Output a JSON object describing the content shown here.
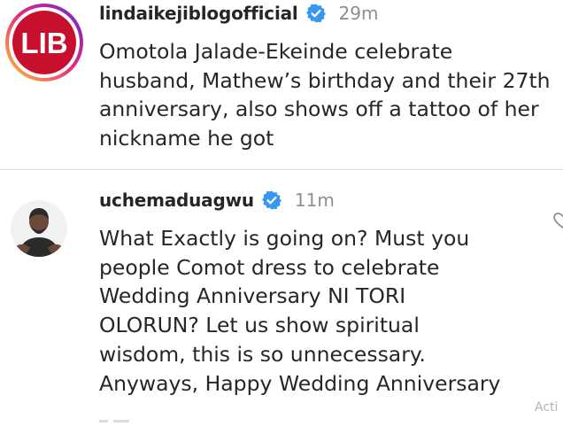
{
  "comments": [
    {
      "username": "lindaikejiblogofficial",
      "time": "29m",
      "verified": true,
      "avatar_text": "LIB",
      "text_lines": [
        "Omotola Jalade-Ekeinde celebrate",
        "husband, Mathew’s birthday and their 27th",
        "anniversary, also shows off a tattoo of her",
        "nickname he got"
      ]
    },
    {
      "username": "uchemaduagwu",
      "time": "11m",
      "verified": true,
      "text_lines": [
        "What Exactly is going on? Must you",
        "people Comot dress to celebrate",
        "Wedding Anniversary NI TORI",
        "OLORUN? Let us show spiritual",
        "wisdom, this is so unnecessary.",
        "Anyways, Happy Wedding Anniversary"
      ]
    }
  ],
  "watermark": "Acti",
  "colors": {
    "text": "#262626",
    "secondary": "#8e8e8e",
    "verified_blue": "#3897f0",
    "lib_red": "#c8102e",
    "story_ring": [
      "#f9ce34",
      "#ee2a7b",
      "#6228d7"
    ]
  }
}
